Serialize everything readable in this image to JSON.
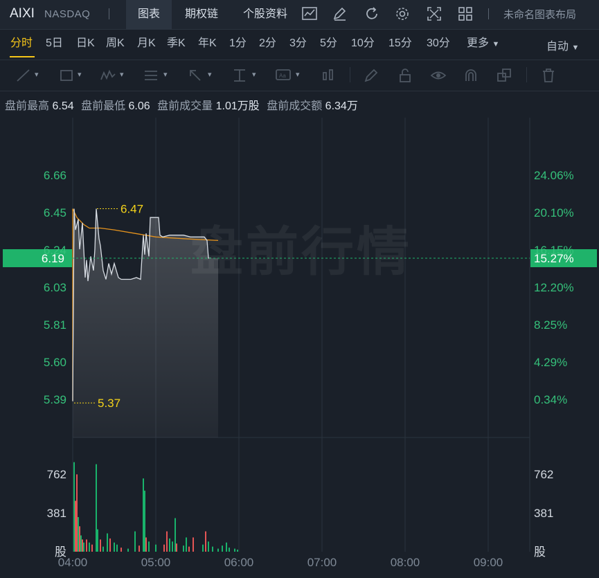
{
  "header": {
    "symbol": "AIXI",
    "exchange": "NASDAQ",
    "tabs": [
      "图表",
      "期权链",
      "个股资料"
    ],
    "layout_name": "未命名图表布局"
  },
  "periods": {
    "items": [
      "分时",
      "5日",
      "日K",
      "周K",
      "月K",
      "季K",
      "年K",
      "1分",
      "2分",
      "3分",
      "5分",
      "10分",
      "15分",
      "30分",
      "更多"
    ],
    "active": "分时",
    "mode": "自动"
  },
  "premarket_stats": {
    "high_label": "盘前最高",
    "high": "6.54",
    "low_label": "盘前最低",
    "low": "6.06",
    "volume_label": "盘前成交量",
    "volume": "1.01万股",
    "amount_label": "盘前成交额",
    "amount": "6.34万"
  },
  "chart_data": {
    "type": "line",
    "watermark": "盘前行情",
    "price_axis_left": [
      "6.66",
      "6.45",
      "6.24",
      "6.03",
      "5.81",
      "5.60",
      "5.39"
    ],
    "percent_axis_right": [
      "24.06%",
      "20.10%",
      "16.15%",
      "12.20%",
      "8.25%",
      "4.29%",
      "0.34%"
    ],
    "y_range": [
      5.39,
      6.66
    ],
    "current_price": "6.19",
    "current_percent": "15.27%",
    "max_marker": "6.47",
    "min_marker": "5.37",
    "x_ticks": [
      "04:00",
      "05:00",
      "06:00",
      "07:00",
      "08:00",
      "09:00"
    ],
    "volume_axis": [
      "762",
      "381"
    ],
    "volume_unit": "股",
    "colors": {
      "price_line": "#d8dde4",
      "avg_line": "#e5931d",
      "up": "#19b36b",
      "down": "#e55555",
      "current": "#1fb36a",
      "marker": "#f5d31a"
    },
    "price_series": [
      [
        "04:00",
        5.38
      ],
      [
        "04:01",
        6.47
      ],
      [
        "04:02",
        6.35
      ],
      [
        "04:04",
        6.41
      ],
      [
        "04:05",
        6.24
      ],
      [
        "04:07",
        6.39
      ],
      [
        "04:09",
        6.08
      ],
      [
        "04:10",
        6.18
      ],
      [
        "04:11",
        6.06
      ],
      [
        "04:13",
        6.2
      ],
      [
        "04:15",
        6.12
      ],
      [
        "04:16",
        6.24
      ],
      [
        "04:17",
        6.47
      ],
      [
        "04:19",
        6.3
      ],
      [
        "04:20",
        6.26
      ],
      [
        "04:22",
        6.12
      ],
      [
        "04:24",
        6.07
      ],
      [
        "04:26",
        6.16
      ],
      [
        "04:28",
        6.1
      ],
      [
        "04:30",
        6.16
      ],
      [
        "04:33",
        6.08
      ],
      [
        "04:35",
        6.07
      ],
      [
        "04:42",
        6.07
      ],
      [
        "04:46",
        6.08
      ],
      [
        "04:49",
        6.07
      ],
      [
        "04:51",
        6.32
      ],
      [
        "04:52",
        6.21
      ],
      [
        "04:53",
        6.33
      ],
      [
        "04:55",
        6.2
      ],
      [
        "04:56",
        6.42
      ],
      [
        "05:02",
        6.42
      ],
      [
        "05:03",
        6.32
      ],
      [
        "05:05",
        6.31
      ],
      [
        "05:10",
        6.32
      ],
      [
        "05:20",
        6.32
      ],
      [
        "05:25",
        6.31
      ],
      [
        "05:35",
        6.31
      ],
      [
        "05:37",
        6.29
      ],
      [
        "05:38",
        6.19
      ],
      [
        "05:40",
        6.19
      ]
    ],
    "avg_series": [
      [
        "04:00",
        6.47
      ],
      [
        "04:03",
        6.42
      ],
      [
        "04:08",
        6.38
      ],
      [
        "04:12",
        6.36
      ],
      [
        "04:20",
        6.36
      ],
      [
        "04:30",
        6.35
      ],
      [
        "04:45",
        6.33
      ],
      [
        "05:00",
        6.31
      ],
      [
        "05:20",
        6.3
      ],
      [
        "05:45",
        6.29
      ]
    ],
    "volume_bars": [
      [
        "04:01",
        880,
        "up"
      ],
      [
        "04:02",
        500,
        "down"
      ],
      [
        "04:03",
        760,
        "down"
      ],
      [
        "04:04",
        340,
        "up"
      ],
      [
        "04:05",
        250,
        "down"
      ],
      [
        "04:06",
        160,
        "up"
      ],
      [
        "04:07",
        120,
        "down"
      ],
      [
        "04:08",
        90,
        "up"
      ],
      [
        "04:10",
        120,
        "down"
      ],
      [
        "04:12",
        90,
        "up"
      ],
      [
        "04:14",
        70,
        "down"
      ],
      [
        "04:17",
        860,
        "up"
      ],
      [
        "04:18",
        220,
        "up"
      ],
      [
        "04:20",
        120,
        "down"
      ],
      [
        "04:22",
        50,
        "up"
      ],
      [
        "04:25",
        180,
        "up"
      ],
      [
        "04:27",
        130,
        "down"
      ],
      [
        "04:30",
        90,
        "up"
      ],
      [
        "04:32",
        70,
        "up"
      ],
      [
        "04:35",
        40,
        "down"
      ],
      [
        "04:40",
        30,
        "up"
      ],
      [
        "04:45",
        200,
        "up"
      ],
      [
        "04:48",
        60,
        "down"
      ],
      [
        "04:51",
        720,
        "up"
      ],
      [
        "04:52",
        600,
        "up"
      ],
      [
        "04:53",
        140,
        "down"
      ],
      [
        "04:55",
        100,
        "up"
      ],
      [
        "05:00",
        70,
        "up"
      ],
      [
        "05:06",
        70,
        "down"
      ],
      [
        "05:08",
        200,
        "down"
      ],
      [
        "05:10",
        130,
        "up"
      ],
      [
        "05:12",
        100,
        "up"
      ],
      [
        "05:14",
        330,
        "up"
      ],
      [
        "05:15",
        80,
        "down"
      ],
      [
        "05:20",
        60,
        "up"
      ],
      [
        "05:22",
        140,
        "up"
      ],
      [
        "05:24",
        50,
        "down"
      ],
      [
        "05:27",
        140,
        "down"
      ],
      [
        "05:34",
        70,
        "up"
      ],
      [
        "05:36",
        200,
        "down"
      ],
      [
        "05:38",
        100,
        "up"
      ],
      [
        "05:41",
        50,
        "up"
      ],
      [
        "05:45",
        30,
        "up"
      ],
      [
        "05:48",
        60,
        "up"
      ],
      [
        "05:51",
        90,
        "up"
      ],
      [
        "05:53",
        40,
        "up"
      ],
      [
        "05:57",
        30,
        "up"
      ],
      [
        "05:59",
        20,
        "up"
      ]
    ]
  }
}
